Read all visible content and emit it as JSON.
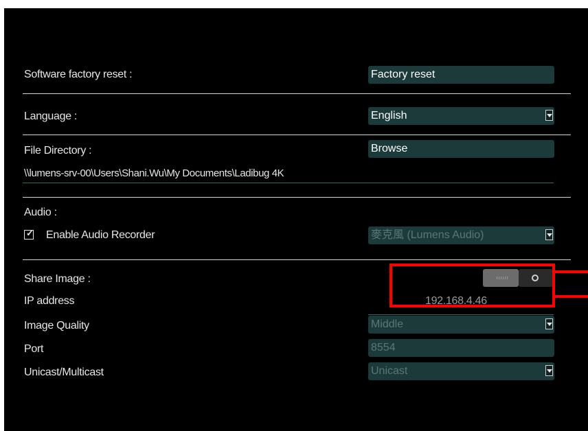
{
  "reset": {
    "label": "Software factory reset :",
    "button": "Factory reset"
  },
  "language": {
    "label": "Language :",
    "value": "English"
  },
  "directory": {
    "label": "File Directory :",
    "button": "Browse",
    "path": "\\\\lumens-srv-00\\Users\\Shani.Wu\\My Documents\\Ladibug 4K"
  },
  "audio": {
    "label": "Audio :",
    "checkbox_label": "Enable Audio Recorder",
    "checked": true,
    "device": "麥克風 (Lumens Audio)"
  },
  "share": {
    "label": "Share Image :",
    "toggle_state": "off"
  },
  "ip": {
    "label": "IP address",
    "value": "192.168.4.46"
  },
  "quality": {
    "label": "Image Quality",
    "value": "Middle"
  },
  "port": {
    "label": "Port",
    "value": "8554"
  },
  "cast": {
    "label": "Unicast/Multicast",
    "value": "Unicast"
  },
  "colors": {
    "panel": "#000000",
    "control": "#1c3a3a",
    "highlight": "#ff0000"
  }
}
